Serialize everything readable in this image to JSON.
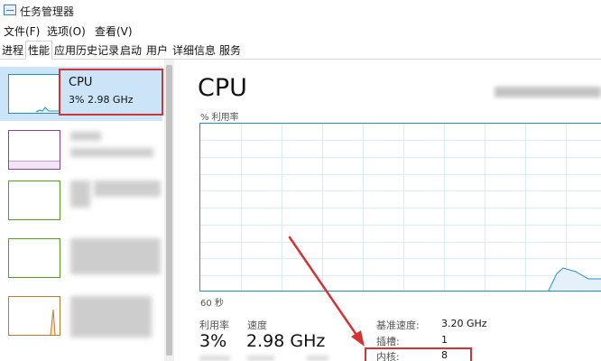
{
  "window": {
    "title": "任务管理器"
  },
  "menu": {
    "items": [
      "文件(F)",
      "选项(O)",
      "查看(V)"
    ]
  },
  "tabs": [
    "进程",
    "性能",
    "应用历史记录",
    "启动",
    "用户",
    "详细信息",
    "服务"
  ],
  "active_tab": "性能",
  "sidebar": {
    "selected": {
      "name": "CPU",
      "detail": "3% 2.98 GHz"
    },
    "thumb_colors": [
      "#1f8ec9",
      "#8b3fa5",
      "#4da31c",
      "#4da31c",
      "#c47a2c"
    ]
  },
  "main": {
    "title": "CPU",
    "utilization_label": "% 利用率",
    "time_label": "60 秒",
    "graph_color": "#1f8ec9",
    "usage_label": "利用率",
    "usage_value": "3%",
    "speed_label": "速度",
    "speed_value": "2.98 GHz",
    "details": {
      "base_speed_label": "基准速度:",
      "base_speed_value": "3.20 GHz",
      "sockets_label": "插槽:",
      "sockets_value": "1",
      "cores_label": "内核:",
      "cores_value": "8"
    }
  },
  "annotation": {
    "color": "#d43333"
  }
}
